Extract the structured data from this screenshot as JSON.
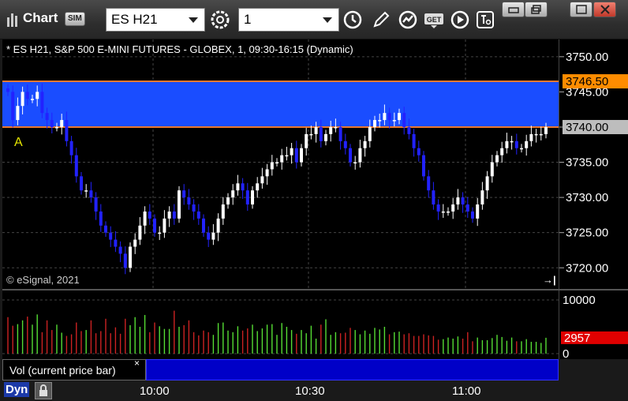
{
  "window": {
    "title": "Chart",
    "badge": "SIM"
  },
  "toolbar": {
    "symbol": "ES H21",
    "interval": "1",
    "icons": [
      "settings-gear-icon",
      "clock-icon",
      "pencil-icon",
      "study-icon",
      "get-icon",
      "play-icon",
      "tools-icon"
    ]
  },
  "window_controls": [
    "restore-icon",
    "maximize-icon",
    "minimize-icon",
    "close-icon"
  ],
  "chart": {
    "label": "* ES H21, S&P 500 E-MINI FUTURES - GLOBEX, 1, 09:30-16:15 (Dynamic)",
    "copyright": "© eSignal, 2021",
    "scroll_glyph": "→|",
    "marker": "A",
    "colors": {
      "up": "#ffffff",
      "down": "#2222ff",
      "zone": "#1a4dff",
      "zone_line": "#e87830",
      "grid": "#444444"
    }
  },
  "volume": {
    "label": "Vol (current price bar)",
    "close_glyph": "×",
    "current_badge": "2957"
  },
  "footer": {
    "mode": "Dyn"
  },
  "chart_data": [
    {
      "type": "candlestick",
      "ylim": [
        3717,
        3752
      ],
      "yticks": [
        "3750.00",
        "3745.00",
        "3740.00",
        "3735.00",
        "3730.00",
        "3725.00",
        "3720.00"
      ],
      "xticks": [
        "10:00",
        "10:30",
        "11:00"
      ],
      "zone": [
        3740,
        3746.5
      ],
      "price_badges": [
        {
          "label": "3746.50",
          "value": 3746.5,
          "bg": "#ff8c00"
        },
        {
          "label": "3740.00",
          "value": 3740.0,
          "bg": "#bdbdbd"
        }
      ],
      "closes": [
        3745,
        3741,
        3743,
        3745,
        3744,
        3744,
        3745,
        3742,
        3741,
        3740,
        3740,
        3741,
        3738,
        3736,
        3733,
        3731,
        3731,
        3730,
        3728,
        3726,
        3725,
        3724,
        3723,
        3722,
        3720,
        3723,
        3724,
        3726,
        3728,
        3727,
        3725,
        3725,
        3727,
        3728,
        3727,
        3731,
        3730,
        3729,
        3728,
        3727,
        3725,
        3724,
        3725,
        3727,
        3729,
        3730,
        3731,
        3732,
        3731,
        3729,
        3731,
        3732,
        3733,
        3734,
        3735,
        3735,
        3736,
        3736,
        3737,
        3735,
        3737,
        3739,
        3739,
        3740,
        3738,
        3739,
        3740,
        3740,
        3738,
        3737,
        3735,
        3735,
        3737,
        3738,
        3740,
        3741,
        3741,
        3742,
        3741,
        3741,
        3742,
        3740,
        3739,
        3737,
        3736,
        3733,
        3731,
        3729,
        3728,
        3728,
        3728,
        3729,
        3730,
        3729,
        3728,
        3727,
        3729,
        3731,
        3733,
        3735,
        3736,
        3737,
        3738,
        3738,
        3737,
        3737,
        3738,
        3739,
        3739,
        3739,
        3740
      ]
    },
    {
      "type": "bar",
      "name": "Vol (current price bar)",
      "ylim": [
        0,
        10000
      ],
      "yticks": [
        "10000",
        "0"
      ],
      "values": [
        6800,
        5200,
        5500,
        6200,
        6900,
        5400,
        7300,
        4000,
        6200,
        4400,
        5400,
        3900,
        3300,
        3600,
        5800,
        4200,
        4400,
        6200,
        3800,
        4200,
        6500,
        3800,
        4900,
        3700,
        6500,
        5300,
        6800,
        5000,
        7200,
        4000,
        5800,
        5100,
        4600,
        4600,
        8000,
        5000,
        5300,
        6200,
        4000,
        3400,
        4300,
        4000,
        3500,
        5700,
        5800,
        4300,
        4000,
        5100,
        4300,
        4700,
        5400,
        4200,
        4700,
        5400,
        5500,
        3500,
        5700,
        5000,
        4400,
        3700,
        4400,
        3800,
        5200,
        2800,
        5400,
        6400,
        3500,
        4000,
        3800,
        3900,
        4800,
        4400,
        3600,
        4300,
        3700,
        4800,
        4500,
        5000,
        3600,
        4000,
        4100,
        3600,
        3800,
        3300,
        3300,
        3600,
        3400,
        3300,
        2600,
        2700,
        3000,
        2800,
        3200,
        2800,
        4000,
        2300,
        3000,
        2500,
        2500,
        2900,
        3500,
        3100,
        2400,
        3000,
        2300,
        2300,
        2700,
        2200,
        2200,
        2000,
        2957
      ]
    }
  ]
}
